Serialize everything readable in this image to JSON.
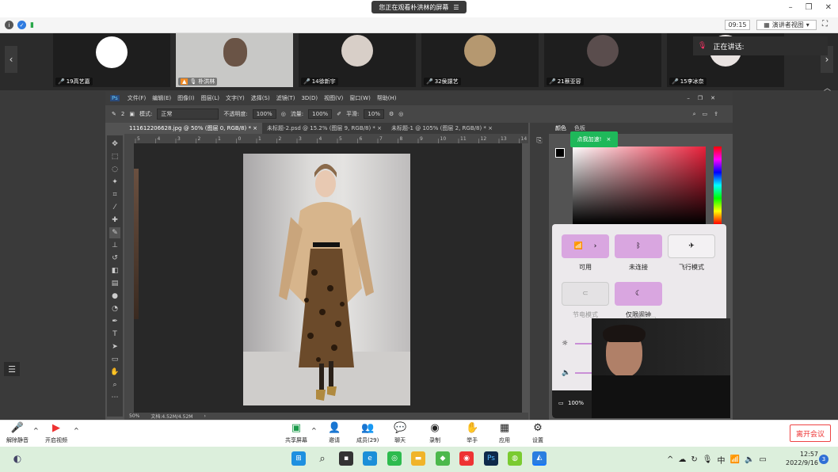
{
  "meeting": {
    "banner": "您正在观看朴洪林的屏幕",
    "time": "09:15",
    "view_mode": "演讲者视图",
    "speaking_label": "正在讲话:",
    "participants": [
      {
        "name": "19高艺嘉"
      },
      {
        "name": "朴洪林"
      },
      {
        "name": "14徐新宇"
      },
      {
        "name": "32侯譞艺"
      },
      {
        "name": "21蔡亚容"
      },
      {
        "name": "15李冰奈"
      }
    ]
  },
  "photoshop": {
    "menu": [
      "文件(F)",
      "编辑(E)",
      "图像(I)",
      "图层(L)",
      "文字(Y)",
      "选择(S)",
      "滤镜(T)",
      "3D(D)",
      "视图(V)",
      "窗口(W)",
      "帮助(H)"
    ],
    "options": {
      "brush_size": "2",
      "mode_label": "模式:",
      "mode_value": "正常",
      "opacity_label": "不透明度:",
      "opacity_value": "100%",
      "flow_label": "流量:",
      "flow_value": "100%",
      "smooth_label": "平滑:",
      "smooth_value": "10%"
    },
    "tabs": [
      "111612206628.jpg @ 50% (图层 0, RGB/8) *",
      "未标题-2.psd @ 15.2% (图层 9, RGB/8) *",
      "未标题-1 @ 105% (图层 2, RGB/8) *"
    ],
    "ruler_marks": [
      "5",
      "4",
      "3",
      "2",
      "1",
      "0",
      "1",
      "2",
      "3",
      "4",
      "5",
      "6",
      "7",
      "8",
      "9",
      "10",
      "11",
      "12",
      "13",
      "14"
    ],
    "status_zoom": "50%",
    "status_doc": "文档:4.52M/4.52M",
    "panel_tabs": [
      "颜色",
      "色板"
    ],
    "toast": "点我加速!"
  },
  "quick_settings": {
    "wifi_label": "可用",
    "bluetooth_label": "未连接",
    "airplane_label": "飞行模式",
    "battery_saver_label": "节电模式",
    "focus_label": "仅限闹钟",
    "brightness_tooltip": "56",
    "brightness": 0.56,
    "volume": 0.96,
    "battery": "100%"
  },
  "controls": {
    "unmute": "解除静音",
    "start_video": "开启视频",
    "share": "共享屏幕",
    "invite": "邀请",
    "members": "成员(29)",
    "chat": "聊天",
    "record": "录制",
    "raise_hand": "举手",
    "apps": "应用",
    "settings": "设置",
    "leave": "离开会议"
  },
  "taskbar": {
    "ime": "中",
    "time": "12:57",
    "date": "2022/9/16",
    "notifications": "3"
  }
}
